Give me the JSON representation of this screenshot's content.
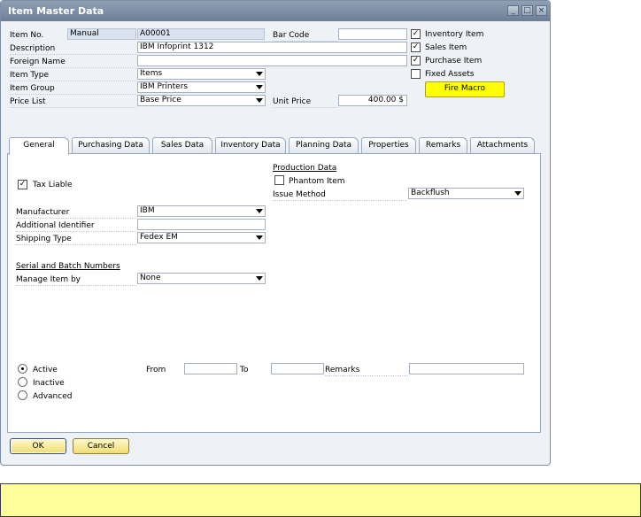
{
  "window": {
    "title": "Item Master Data"
  },
  "header": {
    "item_no_label": "Item No.",
    "item_no_series": "Manual",
    "item_no_value": "A00001",
    "description_label": "Description",
    "description_value": "IBM Infoprint 1312",
    "foreign_name_label": "Foreign Name",
    "foreign_name_value": "",
    "item_type_label": "Item Type",
    "item_type_value": "Items",
    "item_group_label": "Item Group",
    "item_group_value": "IBM Printers",
    "price_list_label": "Price List",
    "price_list_value": "Base Price",
    "bar_code_label": "Bar Code",
    "bar_code_value": "",
    "unit_price_label": "Unit Price",
    "unit_price_value": "400.00 $",
    "inventory_item_label": "Inventory Item",
    "inventory_item_checked": true,
    "sales_item_label": "Sales Item",
    "sales_item_checked": true,
    "purchase_item_label": "Purchase Item",
    "purchase_item_checked": true,
    "fixed_assets_label": "Fixed Assets",
    "fixed_assets_checked": false,
    "fire_macro_label": "Fire Macro"
  },
  "tabs": [
    {
      "label": "General",
      "active": true
    },
    {
      "label": "Purchasing Data",
      "active": false
    },
    {
      "label": "Sales Data",
      "active": false
    },
    {
      "label": "Inventory Data",
      "active": false
    },
    {
      "label": "Planning Data",
      "active": false
    },
    {
      "label": "Properties",
      "active": false
    },
    {
      "label": "Remarks",
      "active": false
    },
    {
      "label": "Attachments",
      "active": false
    }
  ],
  "general": {
    "tax_liable_label": "Tax Liable",
    "tax_liable_checked": true,
    "manufacturer_label": "Manufacturer",
    "manufacturer_value": "IBM",
    "additional_identifier_label": "Additional Identifier",
    "additional_identifier_value": "",
    "shipping_type_label": "Shipping Type",
    "shipping_type_value": "Fedex EM",
    "serial_batch_heading": "Serial and Batch Numbers",
    "manage_item_by_label": "Manage Item by",
    "manage_item_by_value": "None",
    "production_heading": "Production Data",
    "phantom_item_label": "Phantom Item",
    "phantom_item_checked": false,
    "issue_method_label": "Issue Method",
    "issue_method_value": "Backflush",
    "status_active_label": "Active",
    "status_inactive_label": "Inactive",
    "status_advanced_label": "Advanced",
    "status_selected": "Active",
    "from_label": "From",
    "from_value": "",
    "to_label": "To",
    "to_value": "",
    "remarks_label": "Remarks",
    "remarks_value": ""
  },
  "footer": {
    "ok_label": "OK",
    "cancel_label": "Cancel"
  },
  "status_bar": {
    "message": ""
  },
  "colors": {
    "accent_button": "#f1dd73",
    "macro_button": "#ffff00",
    "status_bar": "#ffff99",
    "title_bar": "#7d8da3"
  }
}
